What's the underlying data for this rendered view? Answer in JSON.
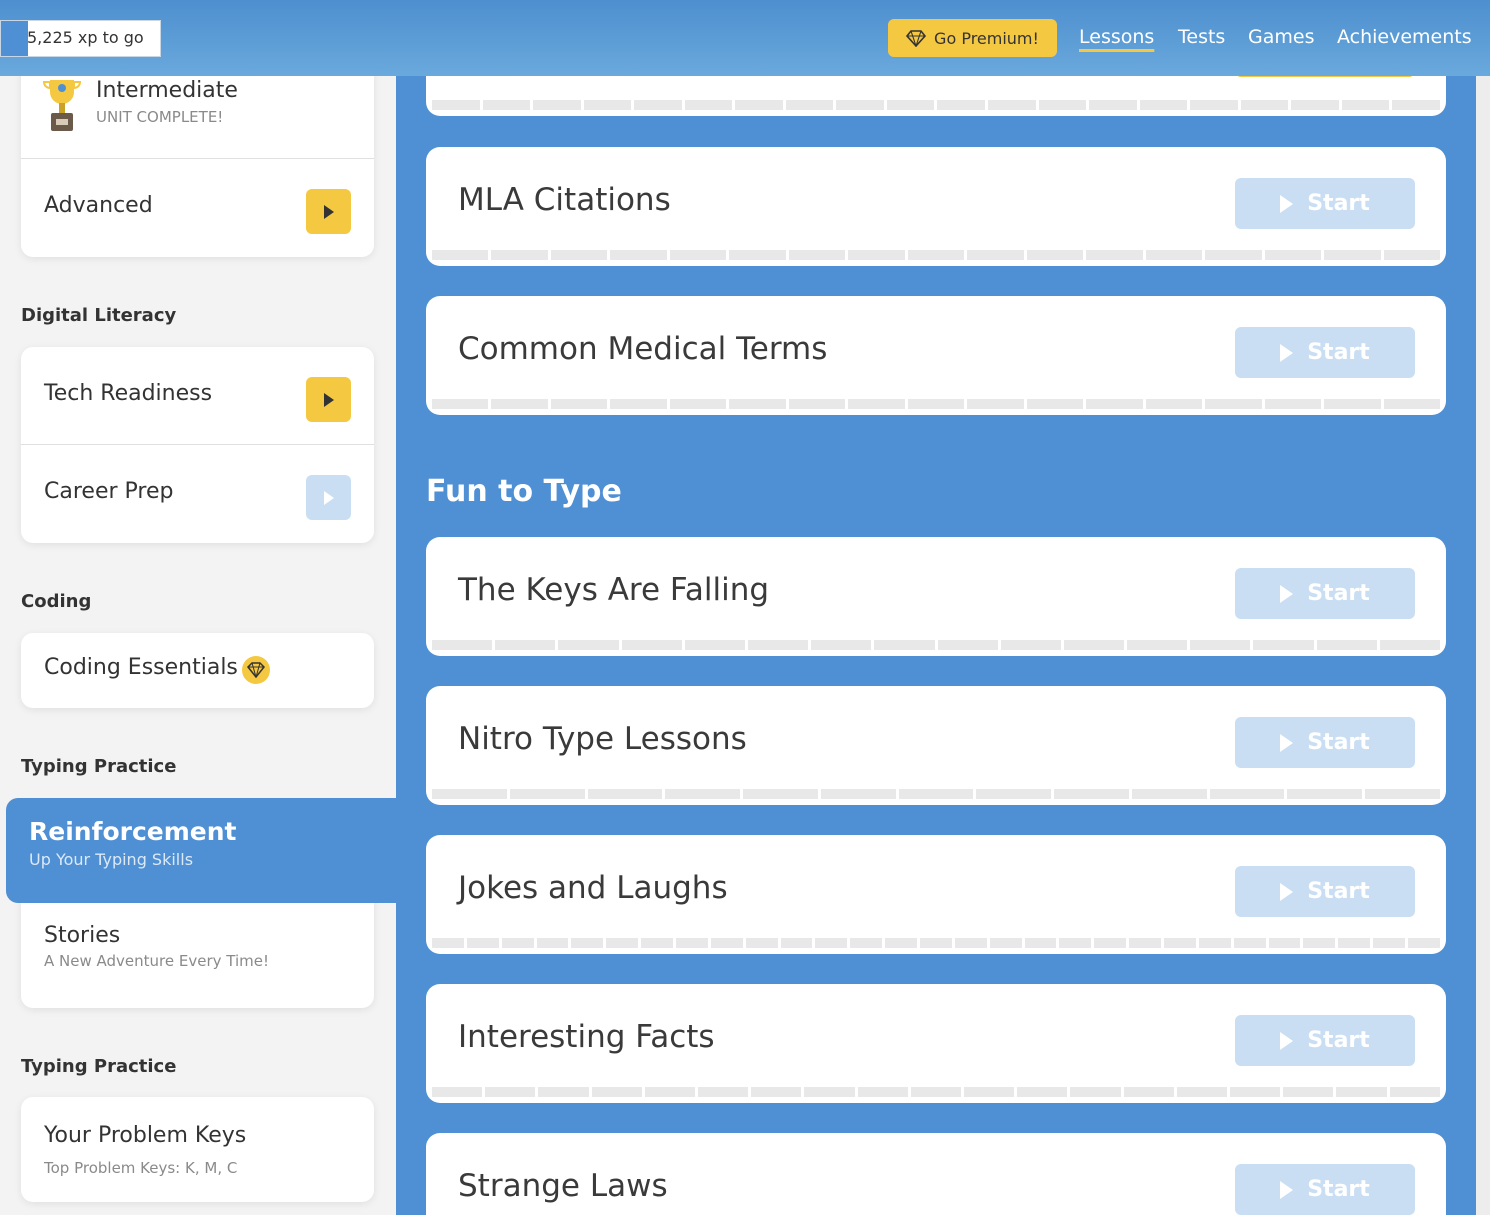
{
  "header": {
    "xp_text": "5,225 xp to go",
    "xp_progress": 0.17,
    "premium_label": "Go Premium!",
    "premium_icon": "diamond-icon",
    "nav": [
      "Lessons",
      "Tests",
      "Games",
      "Achievements"
    ],
    "active_nav": "Lessons"
  },
  "sidebar": {
    "unit_card": {
      "complete_title": "Intermediate",
      "complete_sub": "UNIT COMPLETE!",
      "next_title": "Advanced"
    },
    "sections": [
      {
        "label": "Digital Literacy",
        "items": [
          "Tech Readiness",
          "Career Prep"
        ]
      },
      {
        "label": "Coding",
        "items": [
          "Coding Essentials"
        ]
      },
      {
        "label": "Typing Practice",
        "items": []
      },
      {
        "label": "Typing Practice",
        "items": []
      }
    ],
    "active_item": {
      "title": "Reinforcement",
      "sub": "Up Your Typing Skills"
    },
    "stories": {
      "title": "Stories",
      "sub": "A New Adventure Every Time!"
    },
    "problem_keys": {
      "title": "Your Problem Keys",
      "sub": "Top Problem Keys: K, M, C"
    }
  },
  "main": {
    "section_title": "Fun to Type",
    "start_label": "Start",
    "lessons": [
      {
        "title": "MLA Citations",
        "segments": 17
      },
      {
        "title": "Common Medical Terms",
        "segments": 17
      },
      {
        "title": "The Keys Are Falling",
        "segments": 16
      },
      {
        "title": "Nitro Type Lessons",
        "segments": 13
      },
      {
        "title": "Jokes and Laughs",
        "segments": 29
      },
      {
        "title": "Interesting Facts",
        "segments": 19
      },
      {
        "title": "Strange Laws",
        "segments": 17
      }
    ]
  },
  "colors": {
    "brand_blue": "#4f8fd3",
    "accent_yellow": "#f5c842",
    "disabled_blue": "#c9def3"
  }
}
